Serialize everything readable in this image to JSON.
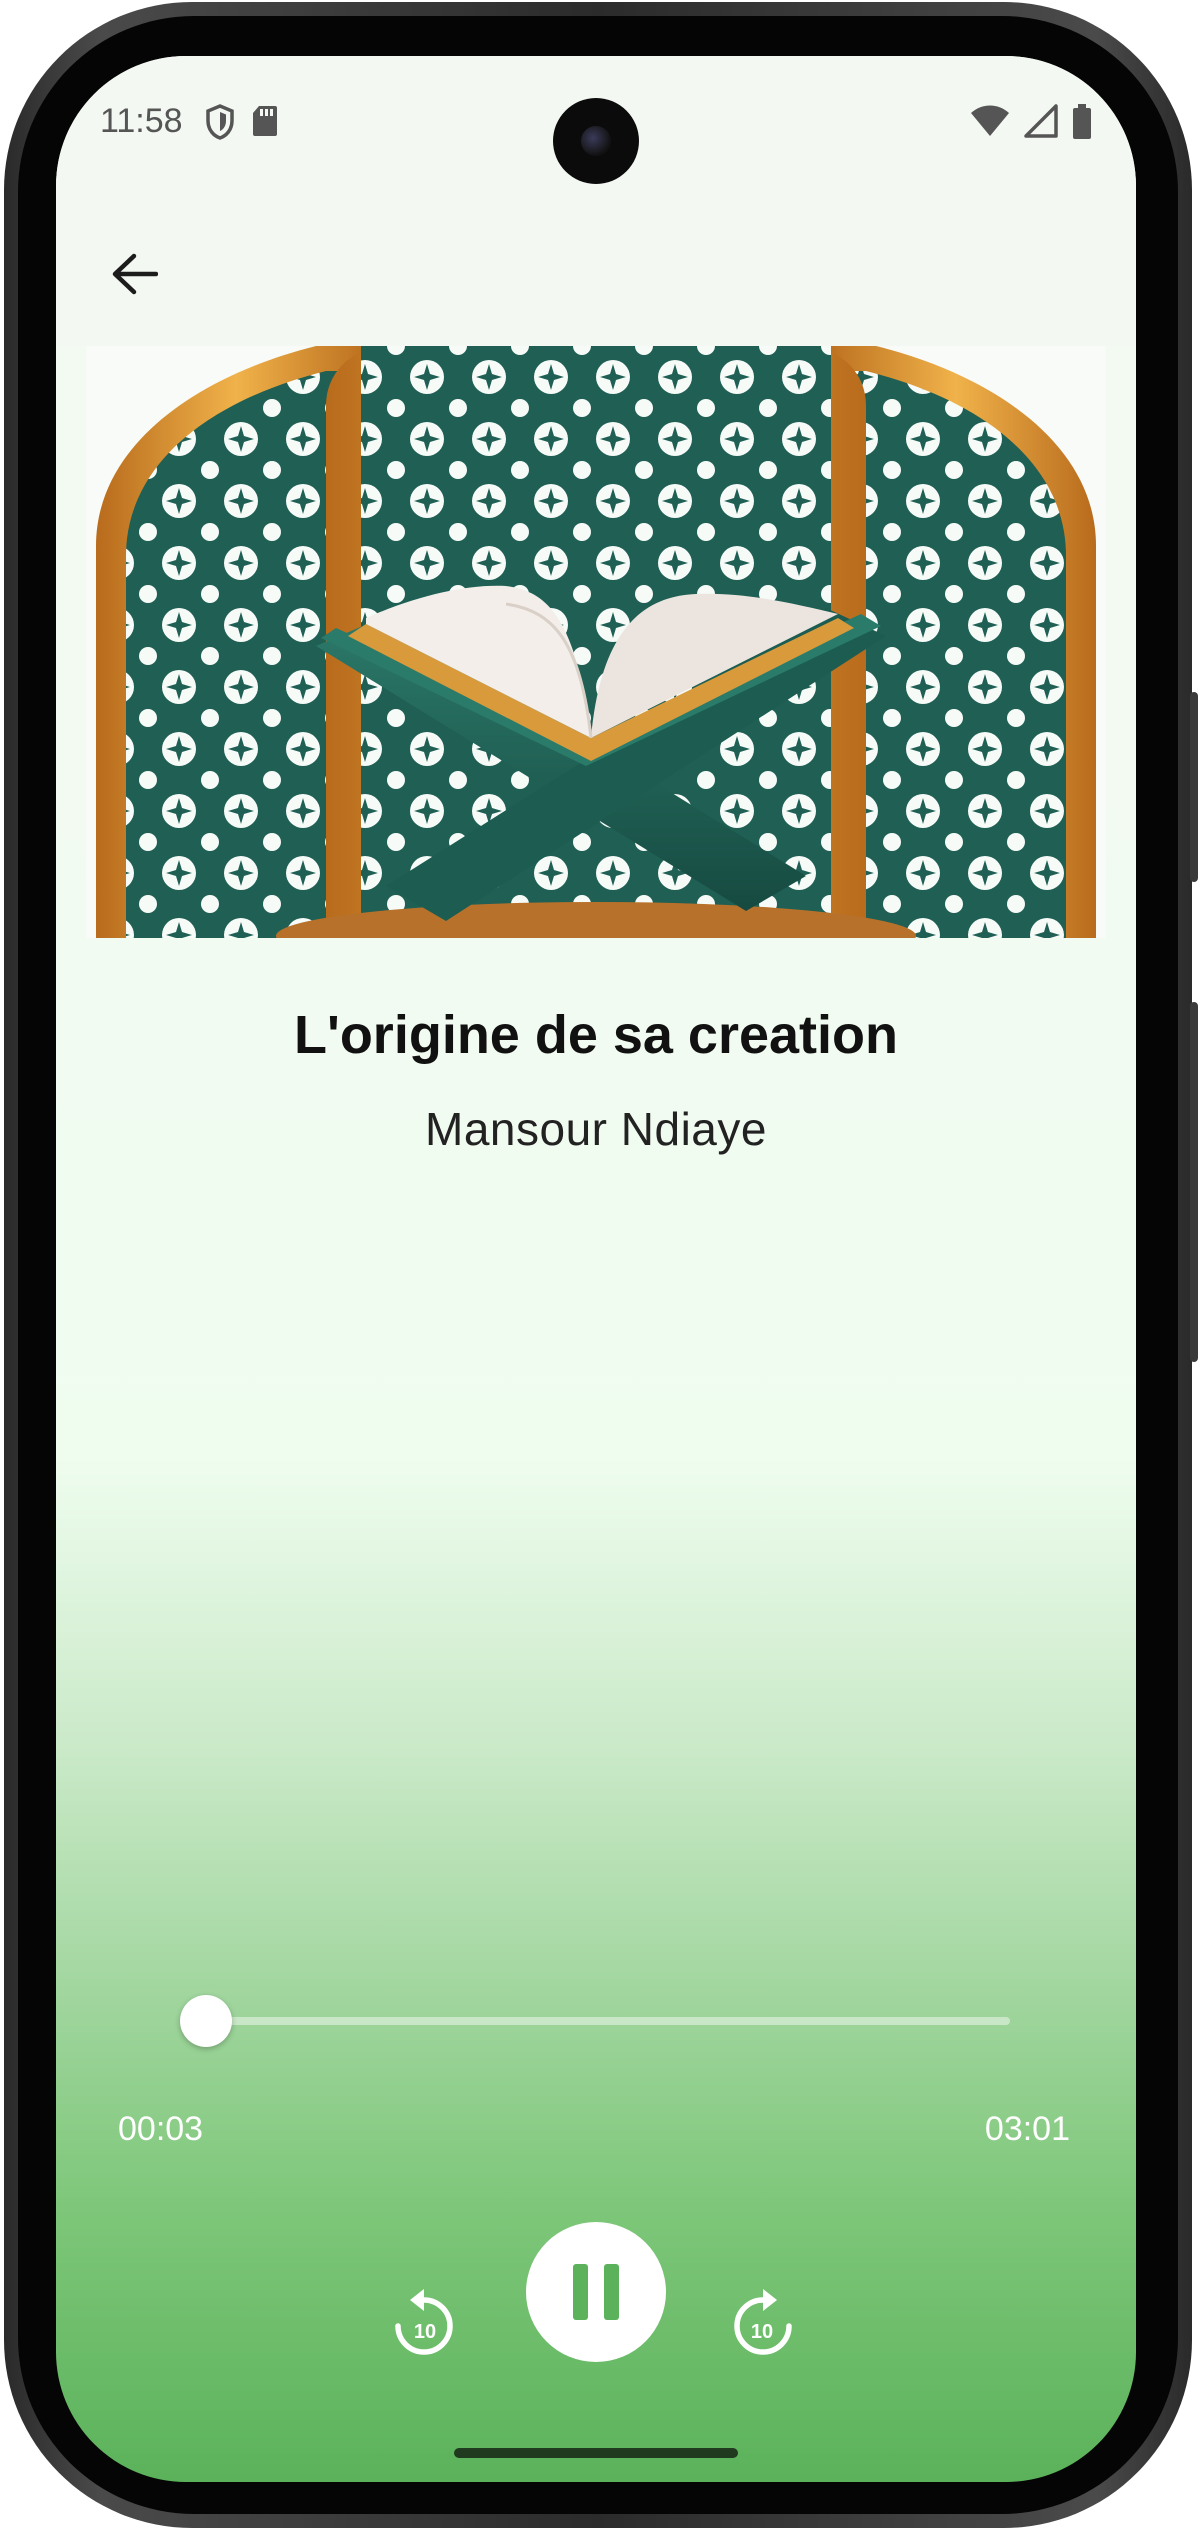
{
  "status_bar": {
    "time": "11:58",
    "left_icons": [
      "shield-icon",
      "sd-card-icon"
    ],
    "right_icons": [
      "wifi-icon",
      "cellular-signal-icon",
      "battery-icon"
    ]
  },
  "header": {
    "back_icon": "arrow-left-icon"
  },
  "cover": {
    "image": "quran-on-rehal-stand-illustration"
  },
  "track": {
    "title": "L'origine de sa creation",
    "artist": "Mansour Ndiaye"
  },
  "player": {
    "current_time": "00:03",
    "total_time": "03:01",
    "progress_fraction": 0.017,
    "rewind_seconds": "10",
    "forward_seconds": "10",
    "state": "playing"
  },
  "colors": {
    "accent_green": "#5bb25a",
    "dark_teal": "#1f5f54",
    "gold": "#d9922e"
  }
}
